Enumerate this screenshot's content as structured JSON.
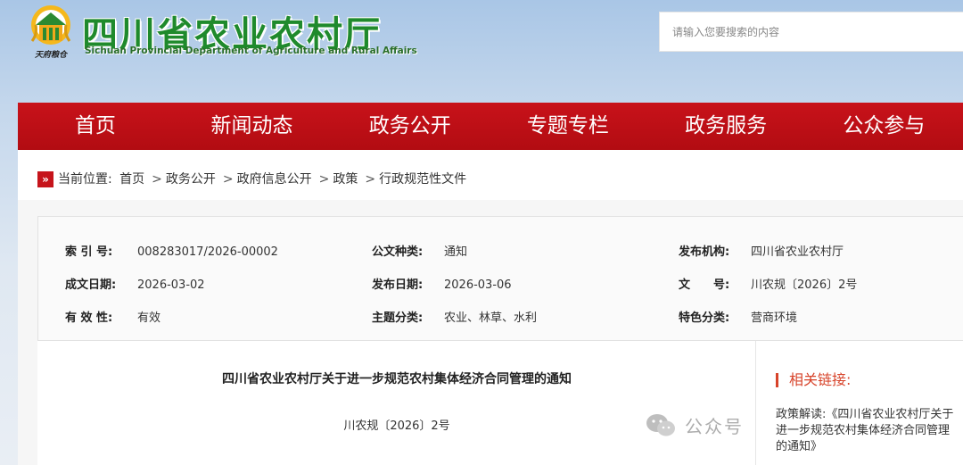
{
  "header": {
    "title": "四川省农业农村厅",
    "subtitle": "Sichuan Provincial Department of Agriculture and Rural Affairs",
    "search_placeholder": "请输入您要搜索的内容",
    "logo_caption": "天府粮仓"
  },
  "nav": {
    "items": [
      "首页",
      "新闻动态",
      "政务公开",
      "专题专栏",
      "政务服务",
      "公众参与"
    ]
  },
  "breadcrumb": {
    "label": "当前位置:",
    "items": [
      "首页",
      "政务公开",
      "政府信息公开",
      "政策",
      "行政规范性文件"
    ],
    "separator": ">"
  },
  "meta": {
    "index_label": "索 引 号:",
    "index_value": "008283017/2026-00002",
    "doc_type_label": "公文种类:",
    "doc_type_value": "通知",
    "issuer_label": "发布机构:",
    "issuer_value": "四川省农业农村厅",
    "created_label": "成文日期:",
    "created_value": "2026-03-02",
    "published_label": "发布日期:",
    "published_value": "2026-03-06",
    "docno_label": "文　　号:",
    "docno_value": "川农规〔2026〕2号",
    "valid_label": "有 效 性:",
    "valid_value": "有效",
    "topic_label": "主题分类:",
    "topic_value": "农业、林草、水利",
    "feature_label": "特色分类:",
    "feature_value": "营商环境"
  },
  "document": {
    "title": "四川省农业农村厅关于进一步规范农村集体经济合同管理的通知",
    "number": "川农规〔2026〕2号"
  },
  "related": {
    "title": "相关链接:",
    "link": "政策解读:《四川省农业农村厅关于进一步规范农村集体经济合同管理的通知》"
  },
  "watermark": {
    "text": "公众号"
  },
  "colors": {
    "nav_red": "#c8121a",
    "title_green": "#1f8a2c",
    "accent_orange": "#d7432a"
  }
}
